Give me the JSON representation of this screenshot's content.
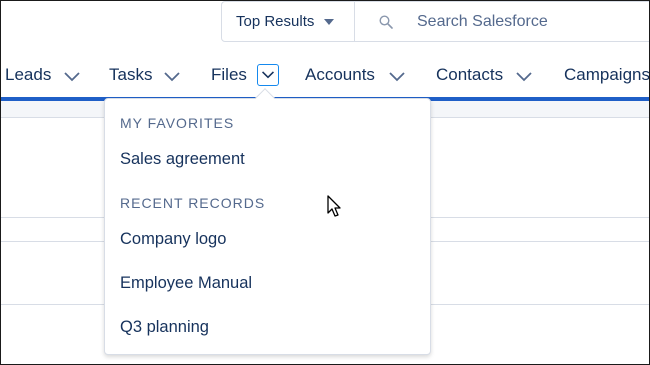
{
  "search": {
    "scope_label": "Top Results",
    "placeholder": "Search Salesforce"
  },
  "nav": {
    "items": [
      {
        "label": "Leads"
      },
      {
        "label": "Tasks"
      },
      {
        "label": "Files"
      },
      {
        "label": "Accounts"
      },
      {
        "label": "Contacts"
      },
      {
        "label": "Campaigns"
      }
    ]
  },
  "menu": {
    "favorites_header": "MY FAVORITES",
    "favorites": [
      {
        "label": "Sales agreement"
      }
    ],
    "recent_header": "RECENT RECORDS",
    "recent": [
      {
        "label": "Company logo"
      },
      {
        "label": "Employee Manual"
      },
      {
        "label": "Q3 planning"
      }
    ]
  },
  "colors": {
    "accent": "#1f5fc7",
    "focus_ring": "#1589ee",
    "text": "#16325c",
    "muted": "#54698d"
  },
  "icons": {
    "search": "magnifier-icon",
    "scope_caret": "caret-down-icon",
    "nav_chevron": "chevron-down-icon",
    "cursor": "mouse-pointer-icon"
  }
}
